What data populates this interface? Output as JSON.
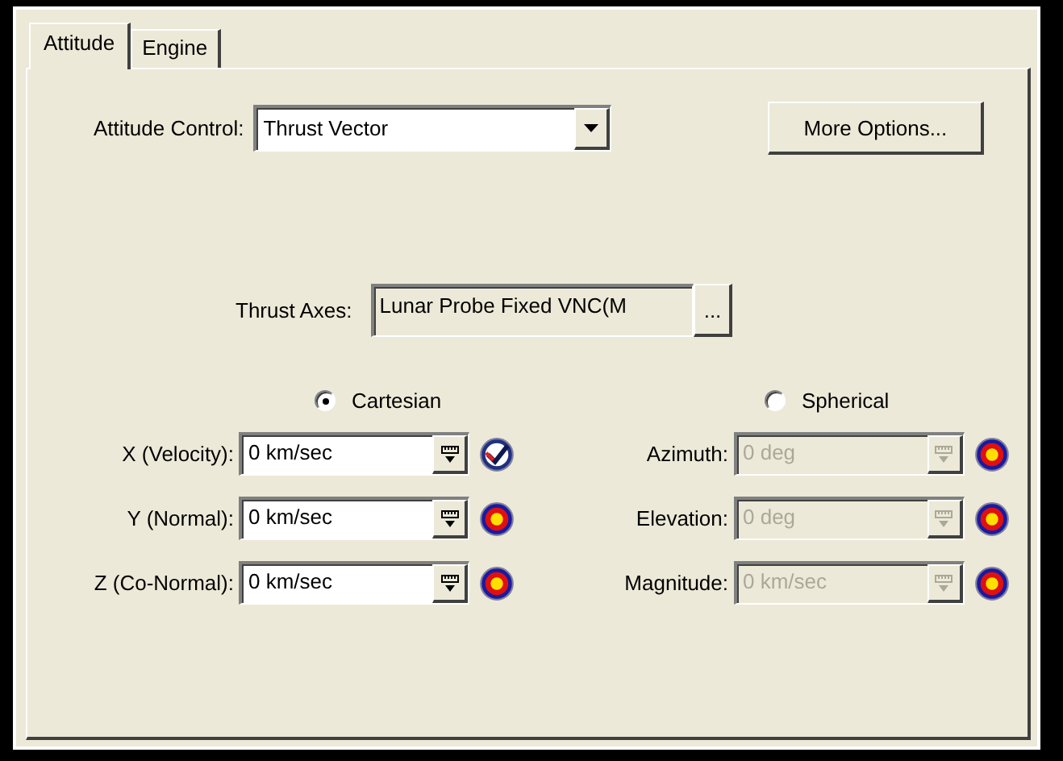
{
  "tabs": [
    {
      "label": "Attitude",
      "selected": true
    },
    {
      "label": "Engine",
      "selected": false
    }
  ],
  "attitude_control": {
    "label": "Attitude Control:",
    "value": "Thrust Vector"
  },
  "more_options_button": "More Options...",
  "thrust_axes": {
    "label": "Thrust Axes:",
    "value": "Lunar Probe Fixed VNC(M",
    "browse_button": "..."
  },
  "coordinate_modes": [
    {
      "label": "Cartesian",
      "selected": true
    },
    {
      "label": "Spherical",
      "selected": false
    }
  ],
  "cartesian_fields": [
    {
      "label": "X (Velocity):",
      "value": "0 km/sec",
      "disabled": false,
      "kind": "checked"
    },
    {
      "label": "Y (Normal):",
      "value": "0 km/sec",
      "disabled": false,
      "kind": "target"
    },
    {
      "label": "Z (Co-Normal):",
      "value": "0 km/sec",
      "disabled": false,
      "kind": "target"
    }
  ],
  "spherical_fields": [
    {
      "label": "Azimuth:",
      "value": "0 deg",
      "disabled": true,
      "kind": "target"
    },
    {
      "label": "Elevation:",
      "value": "0 deg",
      "disabled": true,
      "kind": "target"
    },
    {
      "label": "Magnitude:",
      "value": "0 km/sec",
      "disabled": true,
      "kind": "target"
    }
  ]
}
